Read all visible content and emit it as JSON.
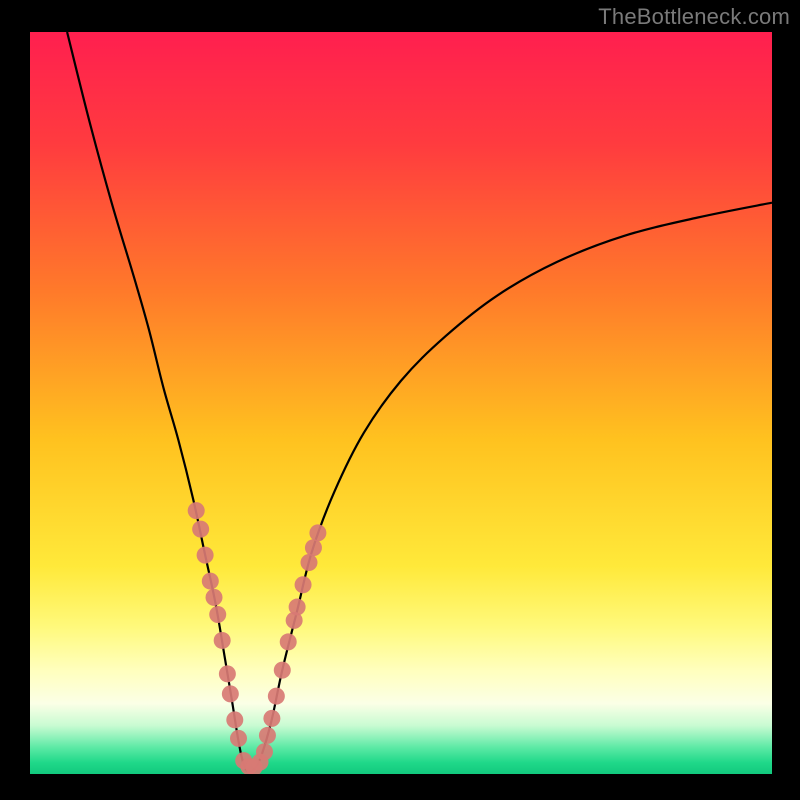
{
  "watermark": "TheBottleneck.com",
  "chart_data": {
    "type": "line",
    "title": "",
    "xlabel": "",
    "ylabel": "",
    "xlim": [
      0,
      100
    ],
    "ylim": [
      0,
      100
    ],
    "grid": false,
    "legend": false,
    "background_gradient_stops": [
      {
        "offset": 0.0,
        "color": "#ff1f4f"
      },
      {
        "offset": 0.15,
        "color": "#ff3b3f"
      },
      {
        "offset": 0.35,
        "color": "#ff7a2a"
      },
      {
        "offset": 0.55,
        "color": "#ffc21f"
      },
      {
        "offset": 0.72,
        "color": "#ffe93a"
      },
      {
        "offset": 0.8,
        "color": "#fff97a"
      },
      {
        "offset": 0.86,
        "color": "#ffffbd"
      },
      {
        "offset": 0.905,
        "color": "#fbffe6"
      },
      {
        "offset": 0.935,
        "color": "#c8fbd2"
      },
      {
        "offset": 0.965,
        "color": "#5ae9a4"
      },
      {
        "offset": 0.985,
        "color": "#1fd889"
      },
      {
        "offset": 1.0,
        "color": "#12c97e"
      }
    ],
    "series": [
      {
        "name": "curve",
        "x": [
          5,
          8,
          11,
          14,
          16,
          18,
          20,
          22,
          23.5,
          25,
          26.2,
          27.2,
          28,
          28.6,
          29.2,
          30,
          31,
          32.5,
          34,
          36,
          38,
          41,
          45,
          50,
          56,
          63,
          71,
          80,
          90,
          100
        ],
        "y": [
          100,
          88,
          77,
          67,
          60,
          52,
          45,
          37,
          30,
          23,
          16,
          10,
          5,
          2,
          0.5,
          0.5,
          2,
          7,
          14,
          22,
          30,
          38,
          46,
          53,
          59,
          64.5,
          69,
          72.5,
          75,
          77
        ]
      }
    ],
    "scatter_clusters": [
      {
        "name": "left-arm-dots",
        "color": "#d87a74",
        "points": [
          {
            "x": 22.4,
            "y": 35.5
          },
          {
            "x": 23.0,
            "y": 33.0
          },
          {
            "x": 23.6,
            "y": 29.5
          },
          {
            "x": 24.3,
            "y": 26.0
          },
          {
            "x": 24.8,
            "y": 23.8
          },
          {
            "x": 25.3,
            "y": 21.5
          },
          {
            "x": 25.9,
            "y": 18.0
          },
          {
            "x": 26.6,
            "y": 13.5
          },
          {
            "x": 27.0,
            "y": 10.8
          },
          {
            "x": 27.6,
            "y": 7.3
          },
          {
            "x": 28.1,
            "y": 4.8
          }
        ]
      },
      {
        "name": "right-arm-dots",
        "color": "#d87a74",
        "points": [
          {
            "x": 32.0,
            "y": 5.2
          },
          {
            "x": 32.6,
            "y": 7.5
          },
          {
            "x": 33.2,
            "y": 10.5
          },
          {
            "x": 34.0,
            "y": 14.0
          },
          {
            "x": 34.8,
            "y": 17.8
          },
          {
            "x": 35.6,
            "y": 20.7
          },
          {
            "x": 36.0,
            "y": 22.5
          },
          {
            "x": 36.8,
            "y": 25.5
          },
          {
            "x": 37.6,
            "y": 28.5
          },
          {
            "x": 38.2,
            "y": 30.5
          },
          {
            "x": 38.8,
            "y": 32.5
          }
        ]
      },
      {
        "name": "bottom-dots",
        "color": "#d87a74",
        "points": [
          {
            "x": 28.8,
            "y": 1.8
          },
          {
            "x": 29.5,
            "y": 1.0
          },
          {
            "x": 30.2,
            "y": 0.9
          },
          {
            "x": 31.0,
            "y": 1.6
          },
          {
            "x": 31.6,
            "y": 3.0
          }
        ]
      }
    ]
  }
}
